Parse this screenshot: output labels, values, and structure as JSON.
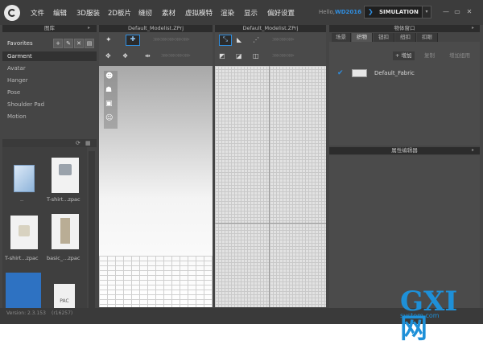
{
  "menu": [
    "文件",
    "编辑",
    "3D服装",
    "2D板片",
    "缝纫",
    "素材",
    "虚拟模特",
    "渲染",
    "显示",
    "偏好设置"
  ],
  "user": {
    "greeting": "Hello,",
    "name": "WD2016"
  },
  "mode": {
    "label": "SIMULATION",
    "dropdown": "▾"
  },
  "window_controls": {
    "minimize": "—",
    "restore": "▭",
    "close": "✕"
  },
  "library": {
    "title": "图库",
    "favorites": "Favorites",
    "items": [
      "Garment",
      "Avatar",
      "Hanger",
      "Pose",
      "Shoulder Pad",
      "Motion"
    ],
    "selected": "Garment",
    "thumbs": [
      {
        "label": ".."
      },
      {
        "label": "T-shirt...zpac"
      },
      {
        "label": "T-shirt...zpac"
      },
      {
        "label": "basic_...zpac"
      },
      {
        "label": ""
      },
      {
        "label": "PAC"
      }
    ],
    "version": "Version: 2.3.153",
    "build": "(r16257)"
  },
  "view3d": {
    "title": "Default_Modelist.ZPrj"
  },
  "view2d": {
    "title": "Default_Modelist.ZPrj"
  },
  "object_window": {
    "title": "物体窗口",
    "tabs": [
      "场景",
      "织物",
      "钮扣",
      "纽扣",
      "扣眼"
    ],
    "active_tab": "织物",
    "buttons": {
      "add": "+ 增加",
      "copy": "复制",
      "add_group": "增加组用"
    },
    "fabric": {
      "name": "Default_Fabric",
      "color": "#e6e6e6"
    }
  },
  "property_editor": {
    "title": "属性编辑器"
  },
  "watermark": {
    "text": "GXI网",
    "sub": "system.com"
  },
  "colors": {
    "accent": "#2f8ee0",
    "panel": "#454545",
    "header": "#2c2c2c"
  }
}
